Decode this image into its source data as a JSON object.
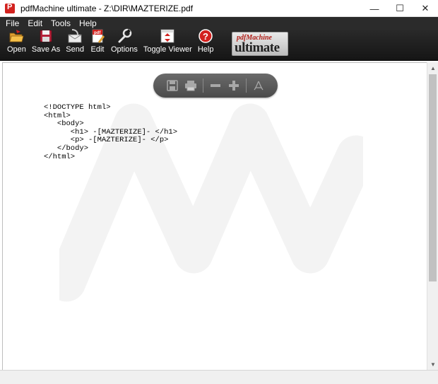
{
  "window": {
    "title": "pdfMachine ultimate - Z:\\DIR\\MAZTERIZE.pdf",
    "controls": {
      "minimize": "—",
      "maximize": "☐",
      "close": "✕"
    }
  },
  "menu": {
    "items": [
      {
        "label": "File"
      },
      {
        "label": "Edit"
      },
      {
        "label": "Tools"
      },
      {
        "label": "Help"
      }
    ]
  },
  "toolbar": {
    "buttons": [
      {
        "label": "Open",
        "icon": "open-folder-icon"
      },
      {
        "label": "Save As",
        "icon": "save-icon"
      },
      {
        "label": "Send",
        "icon": "send-icon"
      },
      {
        "label": "Edit",
        "icon": "edit-pdf-icon"
      },
      {
        "label": "Options",
        "icon": "wrench-icon"
      },
      {
        "label": "Toggle Viewer",
        "icon": "toggle-viewer-icon"
      },
      {
        "label": "Help",
        "icon": "help-icon"
      }
    ],
    "logo": {
      "top": "pdfMachine",
      "main": "ultimate"
    }
  },
  "viewer_bar": {
    "buttons": [
      "save-icon",
      "print-icon",
      "zoom-out-icon",
      "zoom-in-icon",
      "acrobat-icon"
    ]
  },
  "document": {
    "lines": [
      "<!DOCTYPE html>",
      "<html>",
      "   <body>",
      "      <h1> -[MAZTERIZE]- </h1>",
      "      <p> -[MAZTERIZE]- </p>",
      "   </body>",
      "</html>"
    ]
  },
  "colors": {
    "menubar_bg": "#2b2b2b",
    "toolbar_bg": "#1c1c1c",
    "accent_red": "#d2221f",
    "viewer_bar_bg": "#5a5a5a"
  }
}
